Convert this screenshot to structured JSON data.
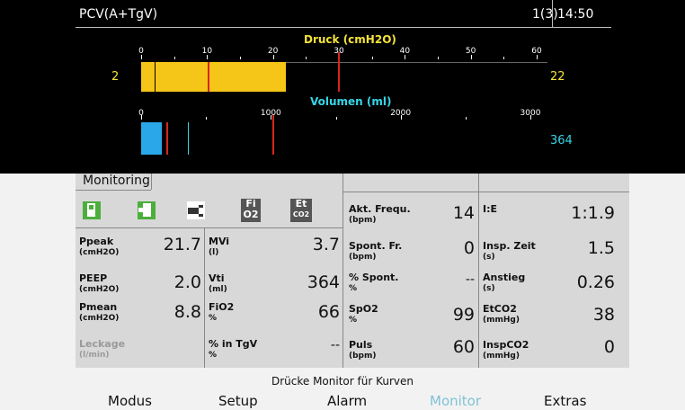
{
  "header": {
    "mode": "PCV(A+TgV)",
    "page": "1(3)",
    "time": "14:50"
  },
  "pressure_bar": {
    "title": "Druck (cmH2O)",
    "ticks": [
      "0",
      "10",
      "20",
      "30",
      "40",
      "50",
      "60"
    ],
    "left_value": "2",
    "right_value": "22",
    "current": 22,
    "max": 60,
    "color": "#f5c518",
    "title_color": "#f5e33a"
  },
  "volume_bar": {
    "title": "Volumen (ml)",
    "ticks": [
      "0",
      "1000",
      "2000",
      "3000"
    ],
    "right_value": "364",
    "current": 364,
    "max": 3000,
    "color": "#2aa7e8",
    "title_color": "#35d6e8"
  },
  "monitoring": {
    "title": "Monitoring",
    "icons": [
      "battery-icon",
      "battery-side-icon",
      "plug-icon",
      "fio2-icon",
      "etco2-icon"
    ],
    "icon_fio2_top": "Fi",
    "icon_fio2_bottom": "O2",
    "icon_etco2_top": "Et",
    "icon_etco2_bottom": "CO2"
  },
  "params": {
    "ppeak": {
      "label": "Ppeak",
      "unit": "(cmH2O)",
      "value": "21.7"
    },
    "peep": {
      "label": "PEEP",
      "unit": "(cmH2O)",
      "value": "2.0"
    },
    "pmean": {
      "label": "Pmean",
      "unit": "(cmH2O)",
      "value": "8.8"
    },
    "leckage": {
      "label": "Leckage",
      "unit": "(l/min)",
      "value": ""
    },
    "mvi": {
      "label": "MVi",
      "unit": "(l)",
      "value": "3.7"
    },
    "vti": {
      "label": "Vti",
      "unit": "(ml)",
      "value": "364"
    },
    "fio2": {
      "label": "FiO2",
      "unit": "%",
      "value": "66"
    },
    "in_tgv": {
      "label": "% in TgV",
      "unit": "%",
      "value": "--"
    },
    "akt_frequ": {
      "label": "Akt. Frequ.",
      "unit": "(bpm)",
      "value": "14"
    },
    "spont_fr": {
      "label": "Spont. Fr.",
      "unit": "(bpm)",
      "value": "0"
    },
    "pct_spont": {
      "label": "% Spont.",
      "unit": "%",
      "value": "--"
    },
    "spo2": {
      "label": "SpO2",
      "unit": "%",
      "value": "99"
    },
    "puls": {
      "label": "Puls",
      "unit": "(bpm)",
      "value": "60"
    },
    "ie": {
      "label": "I:E",
      "unit": "",
      "value": "1:1.9"
    },
    "insp_zeit": {
      "label": "Insp. Zeit",
      "unit": "(s)",
      "value": "1.5"
    },
    "anstieg": {
      "label": "Anstieg",
      "unit": "(s)",
      "value": "0.26"
    },
    "etco2": {
      "label": "EtCO2",
      "unit": "(mmHg)",
      "value": "38"
    },
    "inspco2": {
      "label": "InspCO2",
      "unit": "(mmHg)",
      "value": "0"
    }
  },
  "bottom": {
    "hint": "Drücke Monitor für Kurven",
    "menu": [
      "Modus",
      "Setup",
      "Alarm",
      "Monitor",
      "Extras"
    ],
    "active": "Monitor",
    "active_color": "#7fc2d6"
  }
}
